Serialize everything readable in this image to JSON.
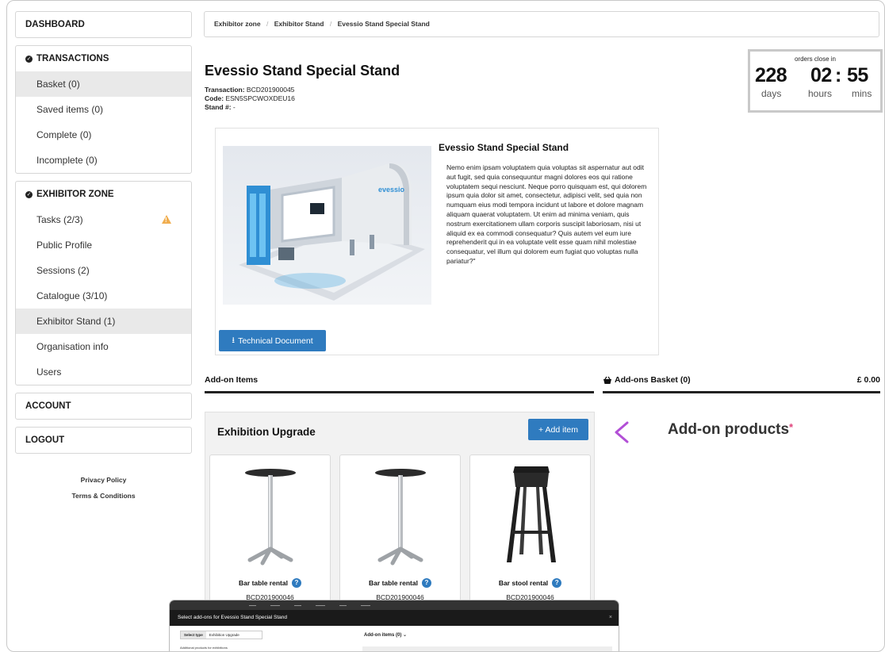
{
  "sidebar": {
    "dashboard": "DASHBOARD",
    "transactions": {
      "heading": "TRANSACTIONS",
      "items": [
        "Basket (0)",
        "Saved items (0)",
        "Complete (0)",
        "Incomplete (0)"
      ]
    },
    "exhibitor_zone": {
      "heading": "EXHIBITOR ZONE",
      "items": [
        "Tasks (2/3)",
        "Public Profile",
        "Sessions (2)",
        "Catalogue (3/10)",
        "Exhibitor Stand (1)",
        "Organisation info",
        "Users"
      ]
    },
    "account": "ACCOUNT",
    "logout": "LOGOUT",
    "privacy_policy": "Privacy Policy",
    "terms": "Terms & Conditions"
  },
  "breadcrumb": [
    "Exhibitor zone",
    "Exhibitor Stand",
    "Evessio Stand Special Stand"
  ],
  "page": {
    "title": "Evessio Stand Special Stand",
    "transaction_label": "Transaction:",
    "transaction_value": "BCD201900045",
    "code_label": "Code:",
    "code_value": "ESN5SPCWOXDEU16",
    "stand_label": "Stand #:",
    "stand_value": "-"
  },
  "countdown": {
    "label": "orders close in",
    "days": "228",
    "days_unit": "days",
    "hours": "02",
    "hours_unit": "hours",
    "separator": ":",
    "mins": "55",
    "mins_unit": "mins"
  },
  "product": {
    "name": "Evessio Stand Special Stand",
    "description": "Nemo enim ipsam voluptatem quia voluptas sit aspernatur aut odit aut fugit, sed quia consequuntur magni dolores eos qui ratione voluptatem sequi nesciunt. Neque porro quisquam est, qui dolorem ipsum quia dolor sit amet, consectetur, adipisci velit, sed quia non numquam eius modi tempora incidunt ut labore et dolore magnam aliquam quaerat voluptatem. Ut enim ad minima veniam, quis nostrum exercitationem ullam corporis suscipit laboriosam, nisi ut aliquid ex ea commodi consequatur? Quis autem vel eum iure reprehenderit qui in ea voluptate velit esse quam nihil molestiae consequatur, vel illum qui dolorem eum fugiat quo voluptas nulla pariatur?\"",
    "brand_text": "evessio",
    "tech_doc_label": "Technical Document"
  },
  "addons": {
    "heading": "Add-on Items",
    "basket_heading": "Add-ons Basket (0)",
    "basket_total": "£ 0.00",
    "panel_title": "Exhibition Upgrade",
    "add_item_label": "+ Add item",
    "items": [
      {
        "name": "Bar table rental",
        "code": "BCD201900046"
      },
      {
        "name": "Bar table rental",
        "code": "BCD201900046"
      },
      {
        "name": "Bar stool rental",
        "code": "BCD201900046"
      }
    ]
  },
  "annotation": {
    "text": "Add-on products",
    "star": "*"
  },
  "modal": {
    "title": "Select add-ons for Evessio Stand Special Stand",
    "close": "×",
    "select_type_label": "Select type",
    "select_type_value": "Exhibition Upgrade",
    "subtext": "Additional products for exhibitions",
    "items_label": "Add-on items (0) ⌄"
  },
  "colors": {
    "primary_button": "#2f7bbf",
    "active_item_bg": "#e9e9e9",
    "warning": "#f0ad4e",
    "arrow_gradient_start": "#b24fd6",
    "arrow_gradient_end": "#f06a3b"
  }
}
